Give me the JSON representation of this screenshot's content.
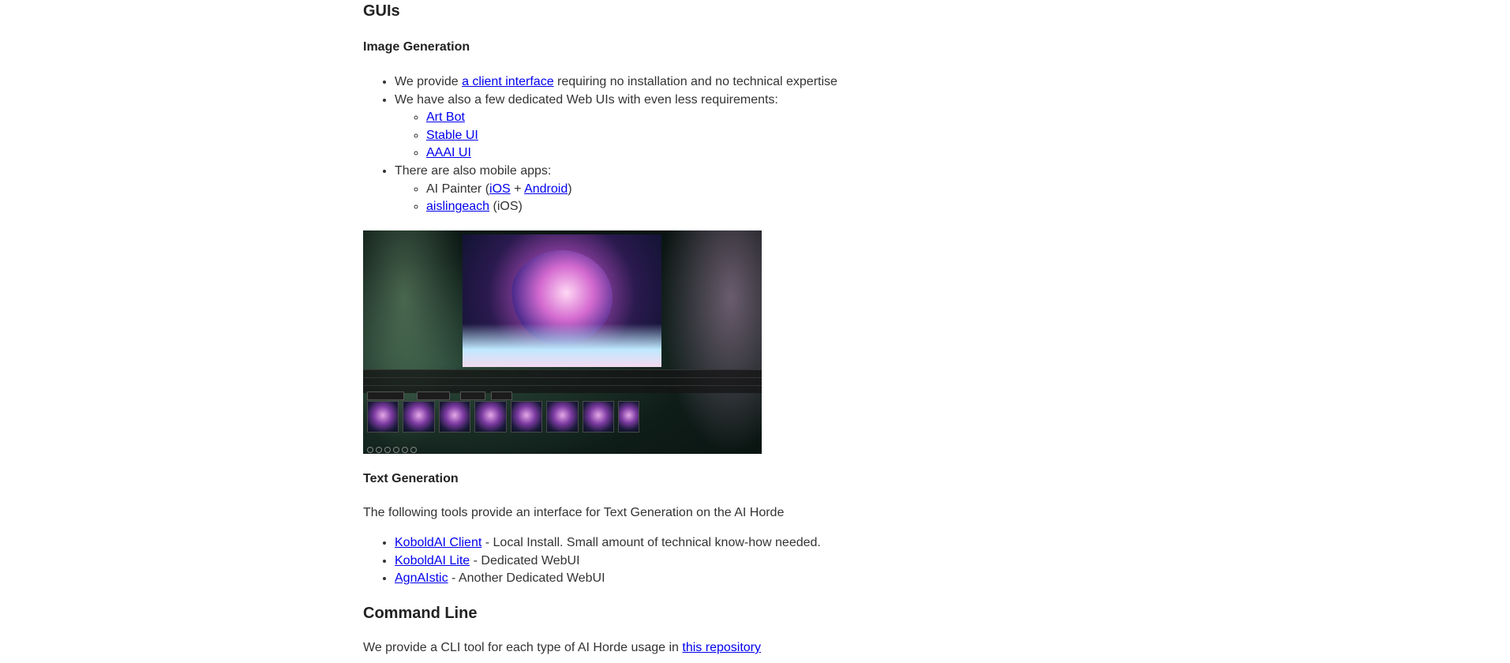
{
  "guis": {
    "title": "GUIs",
    "image_generation": {
      "title": "Image Generation",
      "item1": {
        "before": "We provide ",
        "link": "a client interface",
        "after": " requiring no installation and no technical expertise"
      },
      "item2": {
        "text": "We have also a few dedicated Web UIs with even less requirements:",
        "links": [
          "Art Bot",
          "Stable UI",
          "AAAI UI"
        ]
      },
      "item3": {
        "text": "There are also mobile apps:",
        "ai_painter": {
          "before": "AI Painter (",
          "ios": "iOS",
          "plus": " + ",
          "android": "Android",
          "after": ")"
        },
        "aislingeach": {
          "link": "aislingeach",
          "after": " (iOS)"
        }
      }
    },
    "text_generation": {
      "title": "Text Generation",
      "intro": "The following tools provide an interface for Text Generation on the AI Horde",
      "items": [
        {
          "link": "KoboldAI Client",
          "desc": " - Local Install. Small amount of technical know-how needed."
        },
        {
          "link": "KoboldAI Lite",
          "desc": " - Dedicated WebUI"
        },
        {
          "link": "AgnAIstic",
          "desc": " - Another Dedicated WebUI"
        }
      ]
    }
  },
  "command_line": {
    "title": "Command Line",
    "text_before": "We provide a CLI tool for each type of AI Horde usage in ",
    "link": "this repository"
  }
}
